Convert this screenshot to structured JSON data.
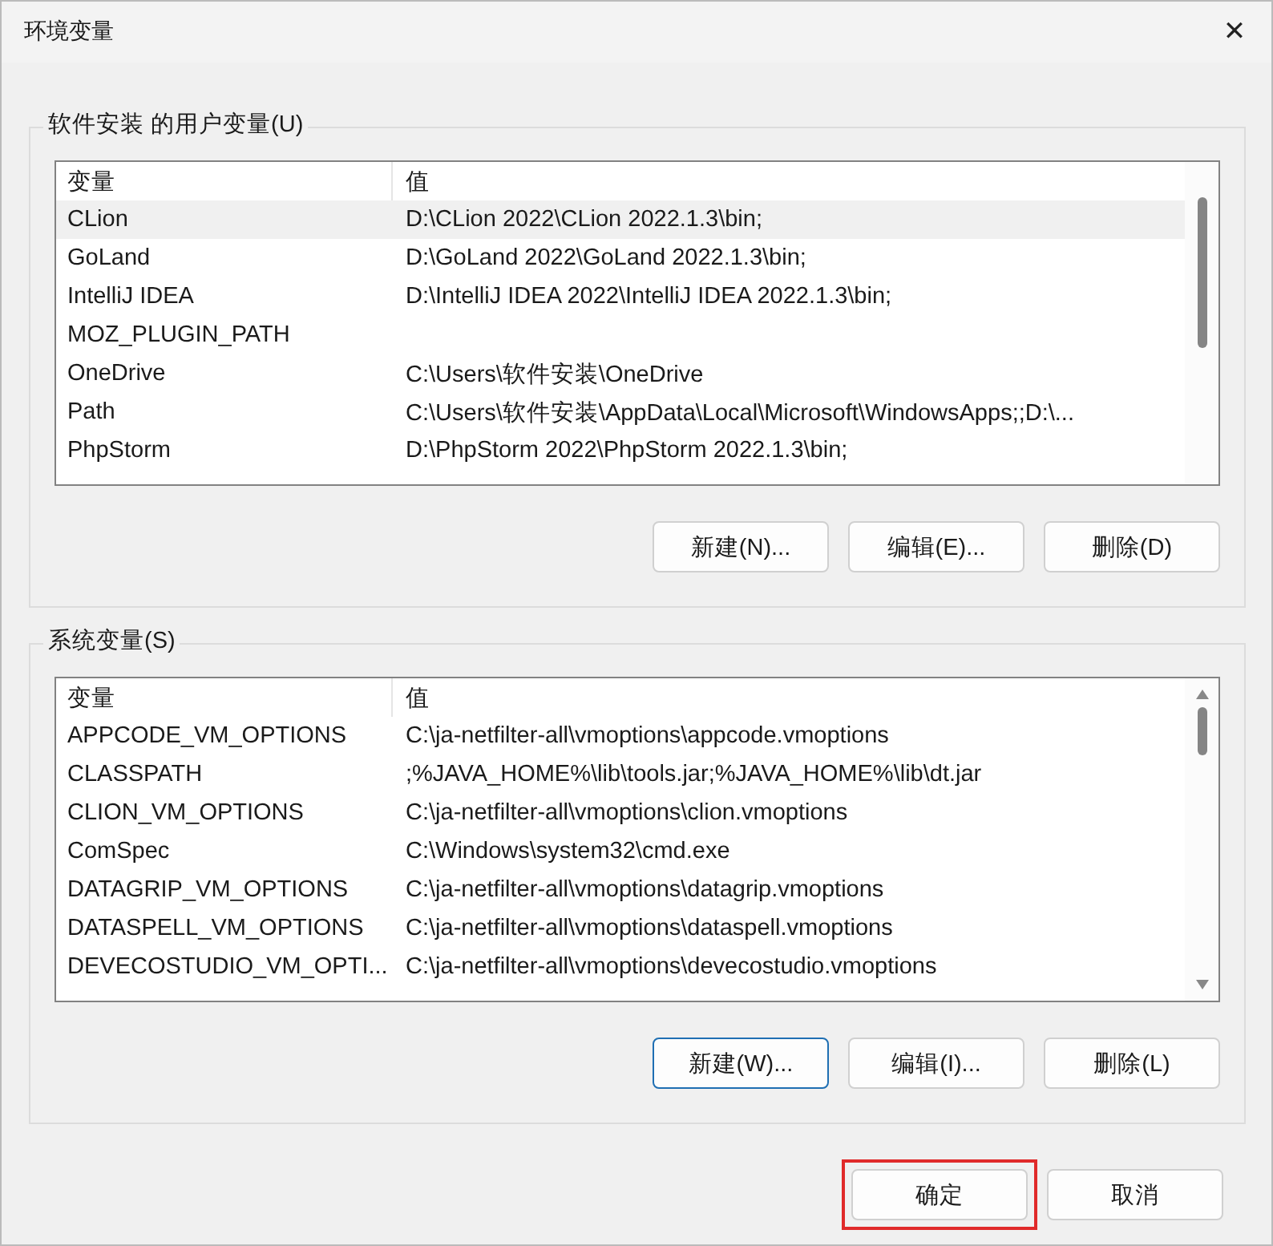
{
  "window": {
    "title": "环境变量",
    "close": "✕"
  },
  "user_vars": {
    "title": "软件安装 的用户变量(U)",
    "columns": [
      "变量",
      "值"
    ],
    "rows": [
      {
        "name": "CLion",
        "value": "D:\\CLion 2022\\CLion 2022.1.3\\bin;",
        "selected": true
      },
      {
        "name": "GoLand",
        "value": "D:\\GoLand 2022\\GoLand 2022.1.3\\bin;",
        "selected": false
      },
      {
        "name": "IntelliJ IDEA",
        "value": "D:\\IntelliJ IDEA 2022\\IntelliJ IDEA 2022.1.3\\bin;",
        "selected": false
      },
      {
        "name": "MOZ_PLUGIN_PATH",
        "value": "",
        "selected": false
      },
      {
        "name": "OneDrive",
        "value": "C:\\Users\\软件安装\\OneDrive",
        "selected": false
      },
      {
        "name": "Path",
        "value": "C:\\Users\\软件安装\\AppData\\Local\\Microsoft\\WindowsApps;;D:\\...",
        "selected": false
      },
      {
        "name": "PhpStorm",
        "value": "D:\\PhpStorm 2022\\PhpStorm 2022.1.3\\bin;",
        "selected": false
      }
    ],
    "scroll_arrows": false,
    "buttons": [
      {
        "label": "新建(N)...",
        "default": false
      },
      {
        "label": "编辑(E)...",
        "default": false
      },
      {
        "label": "删除(D)",
        "default": false
      }
    ]
  },
  "system_vars": {
    "title": "系统变量(S)",
    "columns": [
      "变量",
      "值"
    ],
    "rows": [
      {
        "name": "APPCODE_VM_OPTIONS",
        "value": "C:\\ja-netfilter-all\\vmoptions\\appcode.vmoptions",
        "selected": false
      },
      {
        "name": "CLASSPATH",
        "value": ";%JAVA_HOME%\\lib\\tools.jar;%JAVA_HOME%\\lib\\dt.jar",
        "selected": false
      },
      {
        "name": "CLION_VM_OPTIONS",
        "value": "C:\\ja-netfilter-all\\vmoptions\\clion.vmoptions",
        "selected": false
      },
      {
        "name": "ComSpec",
        "value": "C:\\Windows\\system32\\cmd.exe",
        "selected": false
      },
      {
        "name": "DATAGRIP_VM_OPTIONS",
        "value": "C:\\ja-netfilter-all\\vmoptions\\datagrip.vmoptions",
        "selected": false
      },
      {
        "name": "DATASPELL_VM_OPTIONS",
        "value": "C:\\ja-netfilter-all\\vmoptions\\dataspell.vmoptions",
        "selected": false
      },
      {
        "name": "DEVECOSTUDIO_VM_OPTI...",
        "value": "C:\\ja-netfilter-all\\vmoptions\\devecostudio.vmoptions",
        "selected": false
      }
    ],
    "scroll_arrows": true,
    "buttons": [
      {
        "label": "新建(W)...",
        "default": true
      },
      {
        "label": "编辑(I)...",
        "default": false
      },
      {
        "label": "删除(L)",
        "default": false
      }
    ]
  },
  "footer_buttons": [
    {
      "label": "确定",
      "highlighted": true
    },
    {
      "label": "取消",
      "highlighted": false
    }
  ]
}
